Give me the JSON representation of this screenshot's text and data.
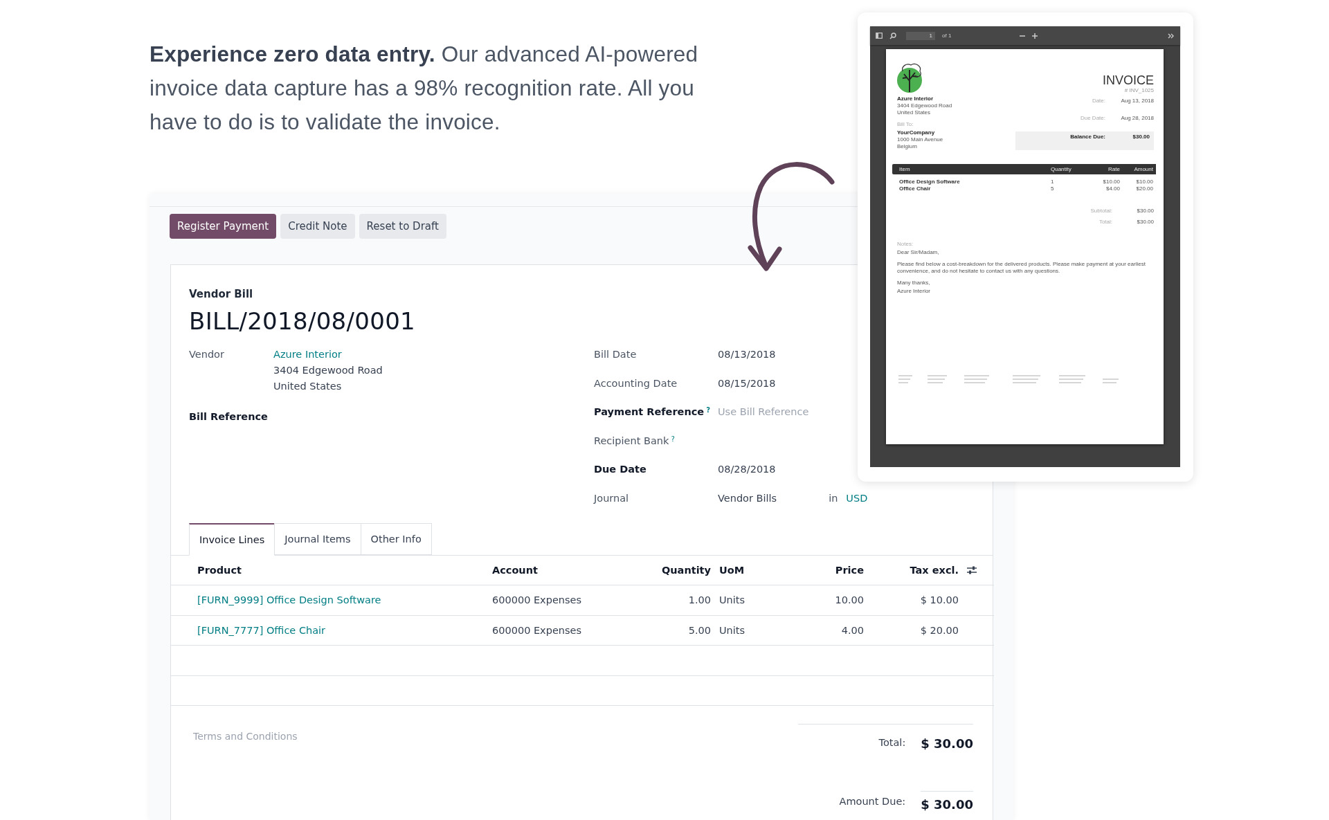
{
  "intro": "**Experience zero data entry.** Our advanced AI-powered invoice data capture has a 98% recognition rate. All you have to do is to validate the invoice.",
  "actions": [
    {
      "label": "Register Payment",
      "primary": true
    },
    {
      "label": "Credit Note",
      "primary": false
    },
    {
      "label": "Reset to Draft",
      "primary": false
    }
  ],
  "form": {
    "type_label": "Vendor Bill",
    "number": "BILL/2018/08/0001",
    "left_fields": [
      {
        "label": "Vendor",
        "required": false,
        "link": "Azure Interior",
        "address": [
          "3404 Edgewood Road",
          "United States"
        ]
      },
      {
        "label": "Bill Reference",
        "required": true
      }
    ],
    "right_fields": [
      {
        "label": "Bill Date",
        "required": false,
        "value": "08/13/2018"
      },
      {
        "label": "Accounting Date",
        "required": false,
        "value": "08/15/2018"
      },
      {
        "label": "Payment Reference",
        "required": true,
        "help": "?",
        "placeholder": "Use Bill Reference"
      },
      {
        "label": "Recipient Bank",
        "required": false,
        "help": "?"
      },
      {
        "label": "Due Date",
        "required": true,
        "value": "08/28/2018"
      },
      {
        "label": "Journal",
        "required": false,
        "value": "Vendor Bills",
        "joiner": "in",
        "link": "USD"
      }
    ],
    "tabs": [
      {
        "label": "Invoice Lines",
        "selected": true
      },
      {
        "label": "Journal Items",
        "selected": false
      },
      {
        "label": "Other Info",
        "selected": false
      }
    ],
    "table": {
      "columns": [
        {
          "label": "Product",
          "kind": "text"
        },
        {
          "label": "Account",
          "kind": "text"
        },
        {
          "label": "Quantity",
          "kind": "number"
        },
        {
          "label": "UoM",
          "kind": "text"
        },
        {
          "label": "Price",
          "kind": "number"
        },
        {
          "label": "Tax excl.",
          "kind": "number"
        }
      ],
      "rows": [
        {
          "cells": [
            "[FURN_9999] Office Design Software",
            "600000 Expenses",
            "1.00",
            "Units",
            "10.00",
            "$ 10.00"
          ]
        },
        {
          "cells": [
            "[FURN_7777] Office Chair",
            "600000 Expenses",
            "5.00",
            "Units",
            "4.00",
            "$ 20.00"
          ]
        }
      ]
    },
    "terms_placeholder": "Terms and Conditions",
    "totals": [
      {
        "label": "Total:",
        "value": "$ 30.00"
      },
      {
        "label": "Amount Due:",
        "value": "$ 30.00"
      }
    ]
  },
  "pdf": {
    "page_input": "1",
    "page_count": "of 1",
    "title": "INVOICE",
    "number": "# INV_1025",
    "from": [
      "Azure Interior",
      "3404 Edgewood Road",
      "United States"
    ],
    "bill_to_label": "Bill To:",
    "bill_to": [
      "YourCompany",
      "1000 Main Avenue",
      "Belgium"
    ],
    "dates": [
      {
        "label": "Date:",
        "value": "Aug 13, 2018"
      },
      {
        "label": "Due Date:",
        "value": "Aug 28, 2018"
      }
    ],
    "balance": {
      "label": "Balance Due:",
      "value": "$30.00"
    },
    "columns": [
      "Item",
      "Quantity",
      "Rate",
      "Amount"
    ],
    "rows": [
      [
        "Office Design Software",
        "1",
        "$10.00",
        "$10.00"
      ],
      [
        "Office Chair",
        "5",
        "$4.00",
        "$20.00"
      ]
    ],
    "summary": [
      {
        "label": "Subtotal:",
        "value": "$30.00"
      },
      {
        "label": "Total:",
        "value": "$30.00"
      }
    ],
    "notes_label": "Notes:",
    "notes": [
      "Dear Sir/Madam,",
      "Please find below a cost-breakdown for the delivered products. Please make payment at your earliest convenience, and do not hesitate to contact us with any questions.",
      "Many thanks,",
      "Azure Interior"
    ]
  }
}
